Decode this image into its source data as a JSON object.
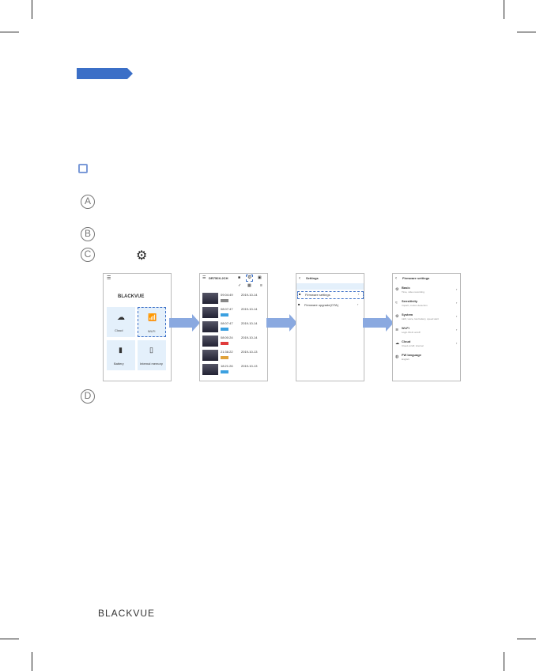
{
  "circles": [
    "A",
    "B",
    "C",
    "D"
  ],
  "phone1": {
    "logo": "BLACKVUE",
    "tiles": [
      "Cloud",
      "Wi-Fi",
      "Battery",
      "Internal memory"
    ]
  },
  "phone2": {
    "title": "DR750X-2CH",
    "rows": [
      {
        "time": "09:04:49",
        "date": "2019-10-14"
      },
      {
        "time": "08:07:47",
        "date": "2019-10-14"
      },
      {
        "time": "08:07:47",
        "date": "2019-10-14"
      },
      {
        "time": "08:00:24",
        "date": "2019-10-14"
      },
      {
        "time": "21:36:22",
        "date": "2019-10-13"
      },
      {
        "time": "18:21:26",
        "date": "2019-10-13"
      }
    ]
  },
  "phone3": {
    "title": "Settings",
    "items": [
      "Firmware settings",
      "Firmware upgrade(OTA)"
    ]
  },
  "phone4": {
    "title": "Firmware settings",
    "items": [
      {
        "label": "Basic",
        "sub": "Time, video recording"
      },
      {
        "label": "Sensitivity",
        "sub": "Impact, motion detection"
      },
      {
        "label": "System",
        "sub": "LED, voice, low battery, speed alert"
      },
      {
        "label": "Wi-Fi",
        "sub": "Login Wi-Fi on/off"
      },
      {
        "label": "Cloud",
        "sub": "Cloud on/off, interval"
      },
      {
        "label": "FW language",
        "sub": "English"
      }
    ]
  },
  "footer": {
    "brand": "BLACKVUE"
  },
  "colors": {
    "accent": "#3b6fc7",
    "arrow": "#8aa9e0"
  }
}
